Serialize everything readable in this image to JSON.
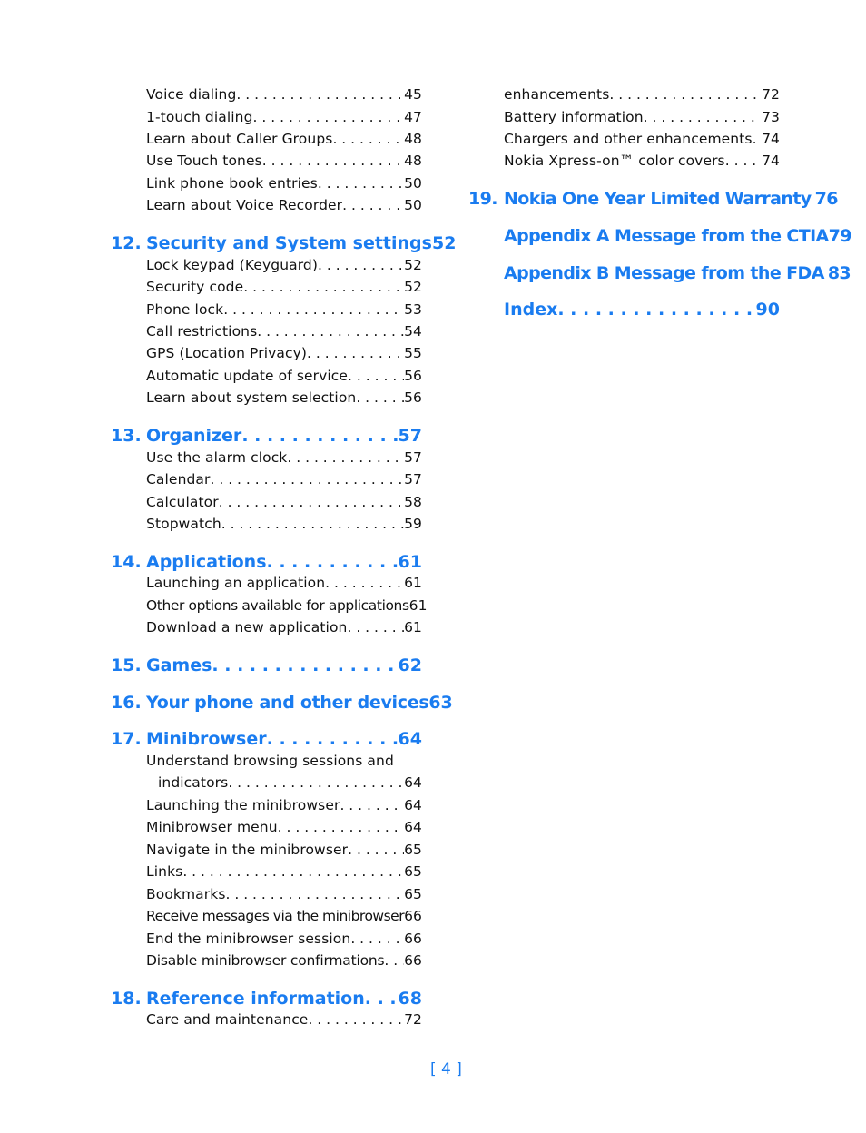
{
  "left_column": {
    "continued_items": [
      {
        "title": "Voice dialing",
        "page": "45"
      },
      {
        "title": "1-touch dialing",
        "page": "47"
      },
      {
        "title": "Learn about Caller Groups",
        "page": "48"
      },
      {
        "title": "Use Touch tones",
        "page": "48"
      },
      {
        "title": "Link phone book entries",
        "page": "50"
      },
      {
        "title": "Learn about Voice Recorder",
        "page": "50"
      }
    ],
    "sections": [
      {
        "number": "12.",
        "title": "Security and System settings",
        "page": "52",
        "items": [
          {
            "title": "Lock keypad (Keyguard)",
            "page": "52"
          },
          {
            "title": "Security code",
            "page": "52"
          },
          {
            "title": "Phone lock",
            "page": "53"
          },
          {
            "title": "Call restrictions",
            "page": "54"
          },
          {
            "title": "GPS (Location Privacy)",
            "page": "55"
          },
          {
            "title": "Automatic update of service",
            "page": "56"
          },
          {
            "title": "Learn about system selection",
            "page": "56"
          }
        ]
      },
      {
        "number": "13.",
        "title": "Organizer",
        "page": "57",
        "items": [
          {
            "title": "Use the alarm clock",
            "page": "57"
          },
          {
            "title": "Calendar",
            "page": "57"
          },
          {
            "title": "Calculator",
            "page": "58"
          },
          {
            "title": "Stopwatch",
            "page": "59"
          }
        ]
      },
      {
        "number": "14.",
        "title": "Applications",
        "page": "61",
        "items": [
          {
            "title": "Launching an application",
            "page": "61"
          },
          {
            "title": "Other options available for applications",
            "page": "61"
          },
          {
            "title": "Download a new application",
            "page": "61"
          }
        ]
      },
      {
        "number": "15.",
        "title": "Games",
        "page": "62",
        "items": []
      },
      {
        "number": "16.",
        "title": "Your phone and other devices",
        "page": "63",
        "items": []
      },
      {
        "number": "17.",
        "title": "Minibrowser",
        "page": "64",
        "items": [
          {
            "title": "Understand browsing sessions and",
            "title_cont": "indicators",
            "page": "64"
          },
          {
            "title": "Launching the minibrowser",
            "page": "64"
          },
          {
            "title": "Minibrowser menu",
            "page": "64"
          },
          {
            "title": "Navigate in the minibrowser",
            "page": "65"
          },
          {
            "title": "Links",
            "page": "65"
          },
          {
            "title": "Bookmarks",
            "page": "65"
          },
          {
            "title": "Receive messages via the minibrowser",
            "page": "66"
          },
          {
            "title": "End the minibrowser session",
            "page": "66"
          },
          {
            "title": "Disable minibrowser confirmations",
            "page": "66"
          }
        ]
      },
      {
        "number": "18.",
        "title": "Reference information",
        "page": "68",
        "items": [
          {
            "title": "Care and maintenance",
            "page": "72"
          }
        ]
      }
    ]
  },
  "right_column": {
    "continued_items": [
      {
        "title": "enhancements",
        "page": "72"
      },
      {
        "title": "Battery information",
        "page": "73"
      },
      {
        "title": "Chargers and other enhancements",
        "page": "74"
      },
      {
        "title": "Nokia Xpress-on™ color covers",
        "page": "74"
      }
    ],
    "sections": [
      {
        "number": "19.",
        "title": "Nokia One Year Limited Warranty",
        "page": "76"
      },
      {
        "number": "",
        "title": "Appendix A Message from the CTIA",
        "page": "79"
      },
      {
        "number": "",
        "title": "Appendix B Message from the FDA",
        "page": "83"
      },
      {
        "number": "",
        "title": "Index",
        "page": "90"
      }
    ]
  },
  "footer": {
    "page_number": "[ 4 ]"
  },
  "colors": {
    "heading": "#1a7cf0",
    "body_text": "#111111"
  }
}
